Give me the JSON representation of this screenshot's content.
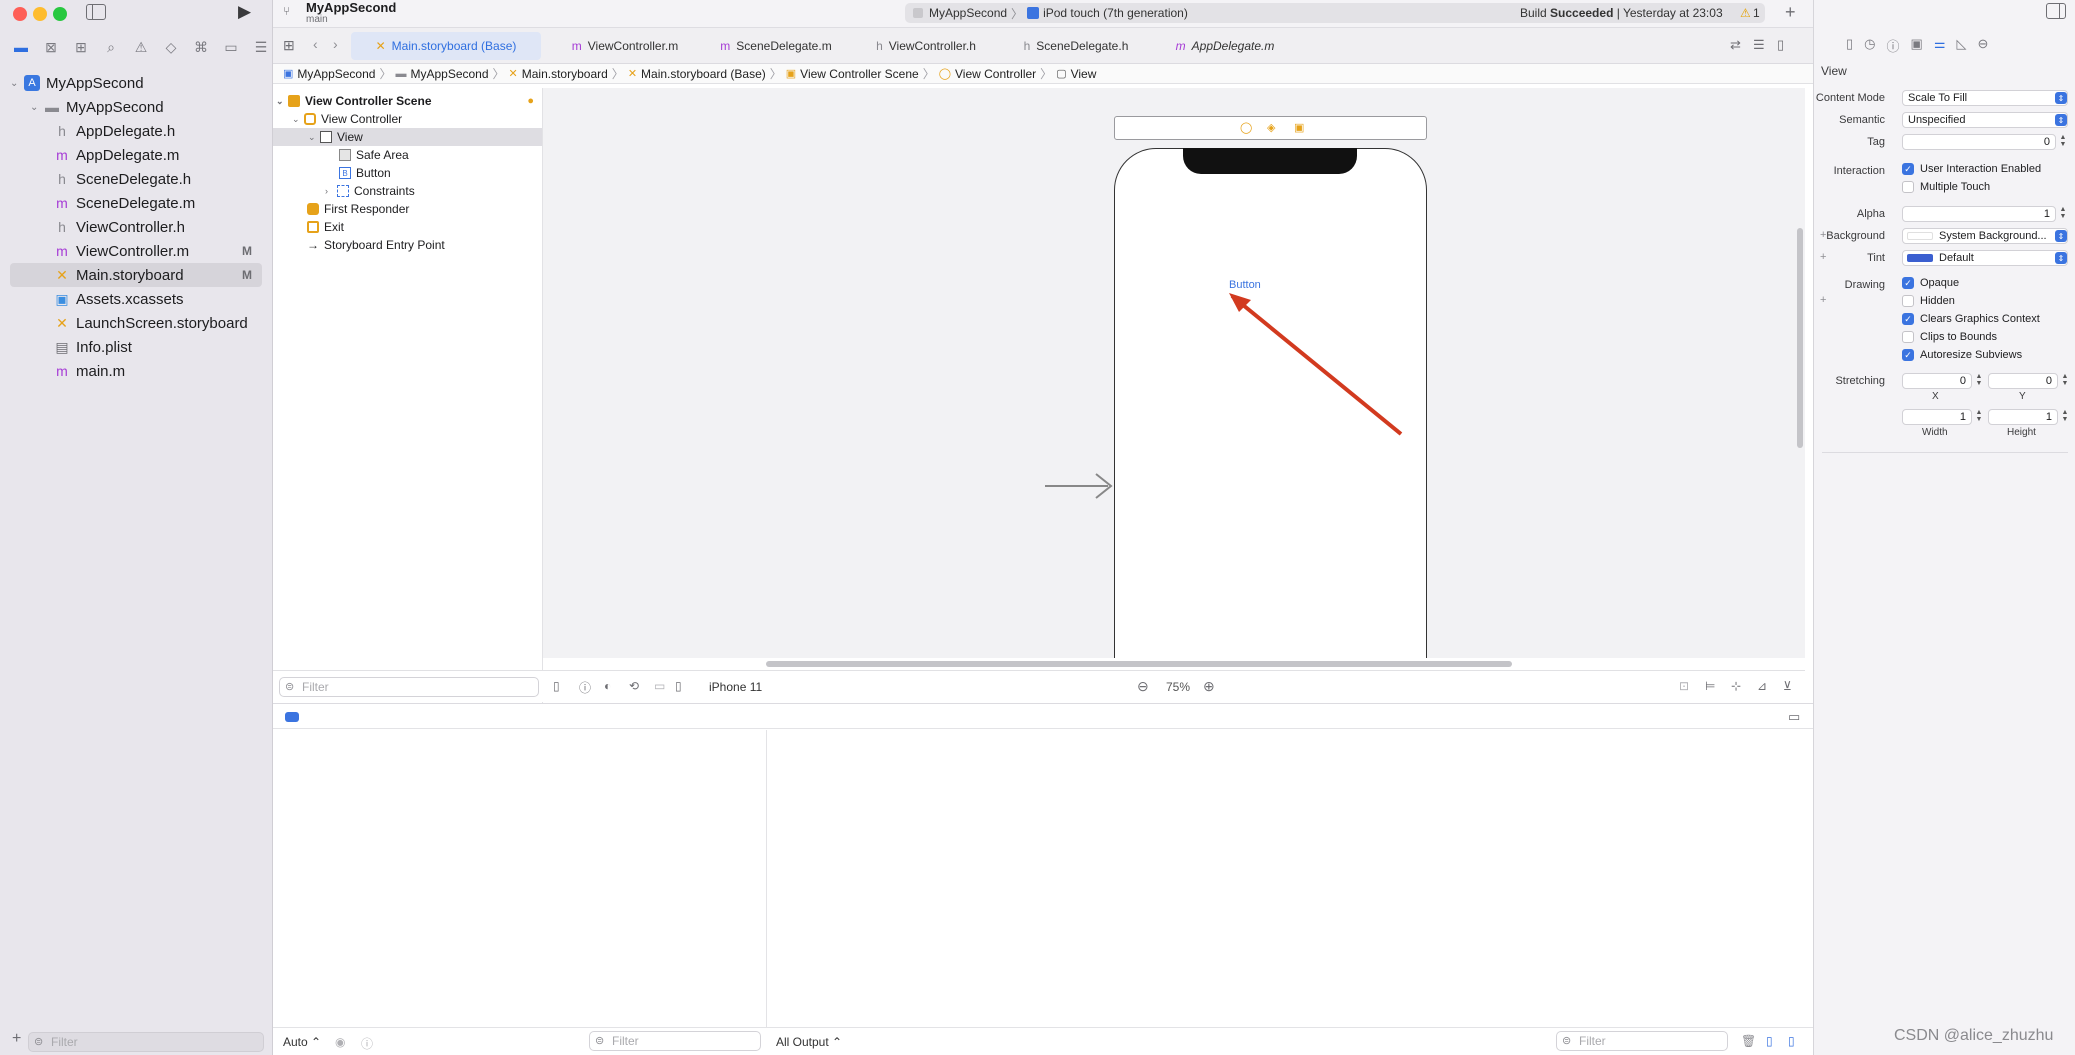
{
  "colors": {
    "accent": "#2f6fe0",
    "arrow": "#d23a1f",
    "warning": "#e6a100",
    "storyboard": "#e6a21a",
    "m_file": "#a63cd6"
  },
  "window": {
    "scheme_title": "MyAppSecond",
    "branch": "main"
  },
  "activity": {
    "scheme": "MyAppSecond",
    "device": "iPod touch (7th generation)",
    "build_prefix": "Build",
    "build_status": "Succeeded",
    "build_time": "| Yesterday at 23:03",
    "warning_count": "1"
  },
  "navigator": {
    "project": "MyAppSecond",
    "group": "MyAppSecond",
    "files": [
      {
        "icon": "h",
        "name": "AppDelegate.h",
        "badge": ""
      },
      {
        "icon": "m",
        "name": "AppDelegate.m",
        "badge": ""
      },
      {
        "icon": "h",
        "name": "SceneDelegate.h",
        "badge": ""
      },
      {
        "icon": "m",
        "name": "SceneDelegate.m",
        "badge": ""
      },
      {
        "icon": "h",
        "name": "ViewController.h",
        "badge": ""
      },
      {
        "icon": "m",
        "name": "ViewController.m",
        "badge": "M"
      },
      {
        "icon": "storyboard",
        "name": "Main.storyboard",
        "badge": "M"
      },
      {
        "icon": "assets",
        "name": "Assets.xcassets",
        "badge": ""
      },
      {
        "icon": "storyboard",
        "name": "LaunchScreen.storyboard",
        "badge": ""
      },
      {
        "icon": "plist",
        "name": "Info.plist",
        "badge": ""
      },
      {
        "icon": "m",
        "name": "main.m",
        "badge": ""
      }
    ],
    "filter_placeholder": "Filter"
  },
  "tabs": [
    {
      "icon": "storyboard",
      "label": "Main.storyboard (Base)"
    },
    {
      "icon": "m",
      "label": "ViewController.m"
    },
    {
      "icon": "m",
      "label": "SceneDelegate.m"
    },
    {
      "icon": "h",
      "label": "ViewController.h"
    },
    {
      "icon": "h",
      "label": "SceneDelegate.h"
    },
    {
      "icon": "m",
      "label": "AppDelegate.m"
    }
  ],
  "jumpbar": [
    "MyAppSecond",
    "MyAppSecond",
    "Main.storyboard",
    "Main.storyboard (Base)",
    "View Controller Scene",
    "View Controller",
    "View"
  ],
  "outline": {
    "scene": "View Controller Scene",
    "controller": "View Controller",
    "view": "View",
    "safe_area": "Safe Area",
    "button": "Button",
    "constraints": "Constraints",
    "first_responder": "First Responder",
    "exit": "Exit",
    "entry_point": "Storyboard Entry Point",
    "filter_placeholder": "Filter"
  },
  "canvas": {
    "button_label": "Button",
    "device": "iPhone 11",
    "zoom": "75%"
  },
  "debug": {
    "auto_label": "Auto",
    "filter_placeholder": "Filter",
    "output_label": "All Output",
    "console_filter": "Filter"
  },
  "inspector": {
    "section": "View",
    "content_mode_label": "Content Mode",
    "content_mode": "Scale To Fill",
    "semantic_label": "Semantic",
    "semantic": "Unspecified",
    "tag_label": "Tag",
    "tag": "0",
    "interaction_label": "Interaction",
    "user_interaction": "User Interaction Enabled",
    "multiple_touch": "Multiple Touch",
    "alpha_label": "Alpha",
    "alpha": "1",
    "background_label": "Background",
    "background": "System Background...",
    "tint_label": "Tint",
    "tint": "Default",
    "drawing_label": "Drawing",
    "opaque": "Opaque",
    "hidden": "Hidden",
    "clears": "Clears Graphics Context",
    "clips": "Clips to Bounds",
    "autoresize": "Autoresize Subviews",
    "stretching_label": "Stretching",
    "x": "0",
    "y": "0",
    "width": "1",
    "height": "1",
    "x_label": "X",
    "y_label": "Y",
    "width_label": "Width",
    "height_label": "Height"
  },
  "watermark": "CSDN @alice_zhuzhu"
}
